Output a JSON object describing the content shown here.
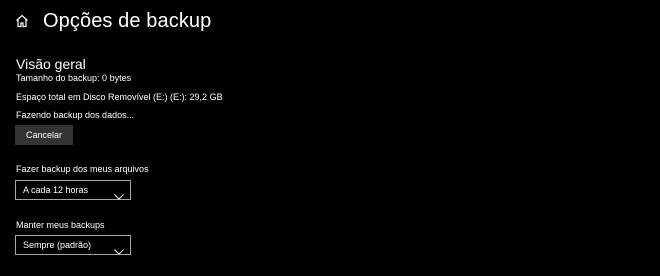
{
  "header": {
    "title": "Opções de backup",
    "home_icon": "home-icon"
  },
  "overview": {
    "title": "Visão geral",
    "backup_size": "Tamanho do backup: 0 bytes",
    "total_space": "Espaço total em Disco Removível (E:) (E:): 29,2 GB",
    "status": "Fazendo backup dos dados...",
    "cancel_label": "Cancelar"
  },
  "backup_frequency": {
    "label": "Fazer backup dos meus arquivos",
    "selected": "A cada 12 horas"
  },
  "keep_backups": {
    "label": "Manter meus backups",
    "selected": "Sempre (padrão)"
  },
  "colors": {
    "background": "#000000",
    "text": "#ffffff",
    "button_bg": "#333333",
    "dropdown_border": "#a6a6a6"
  }
}
